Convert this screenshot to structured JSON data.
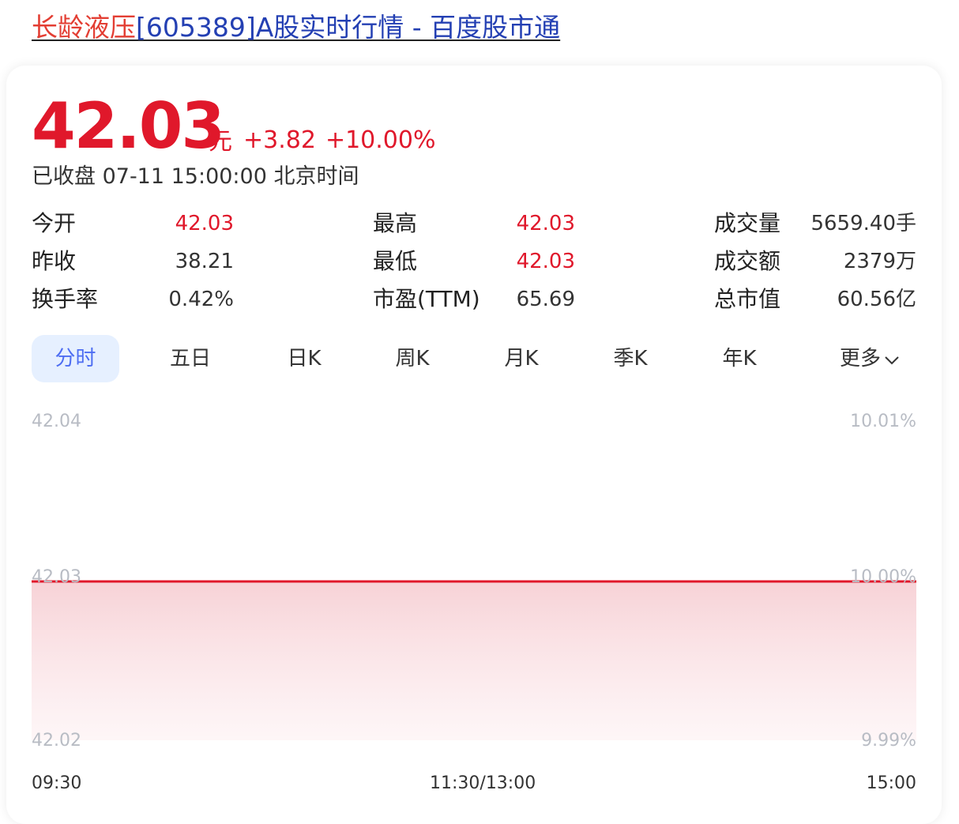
{
  "title": {
    "highlight": "长龄液压",
    "rest": "[605389]A股实时行情 - 百度股市通"
  },
  "quote": {
    "price": "42.03",
    "unit": "元",
    "change": "+3.82",
    "change_percent": "+10.00%",
    "status": "已收盘 07-11 15:00:00 北京时间"
  },
  "stats": {
    "open_label": "今开",
    "open_value": "42.03",
    "prev_close_label": "昨收",
    "prev_close_value": "38.21",
    "turnover_label": "换手率",
    "turnover_value": "0.42%",
    "high_label": "最高",
    "high_value": "42.03",
    "low_label": "最低",
    "low_value": "42.03",
    "pe_label": "市盈(TTM)",
    "pe_value": "65.69",
    "volume_label": "成交量",
    "volume_value": "5659.40手",
    "amount_label": "成交额",
    "amount_value": "2379万",
    "market_cap_label": "总市值",
    "market_cap_value": "60.56亿"
  },
  "tabs": {
    "t0": "分时",
    "t1": "五日",
    "t2": "日K",
    "t3": "周K",
    "t4": "月K",
    "t5": "季K",
    "t6": "年K",
    "t7": "更多",
    "active": "分时",
    "more_icon": "chevron-down-icon"
  },
  "colors": {
    "up": "#e0182b",
    "link": "#2440b3",
    "highlight": "#e33e33",
    "active_tab_bg": "#e6f0ff",
    "active_tab_text": "#4e6ef2",
    "axis": "#b8bcc4",
    "chart_line": "#e0182b"
  },
  "chart_data": {
    "type": "area",
    "title": "",
    "xlabel": "",
    "ylabel": "",
    "y_left_ticks": [
      "42.04",
      "42.03",
      "42.02"
    ],
    "y_right_ticks": [
      "10.01%",
      "10.00%",
      "9.99%"
    ],
    "x_ticks": [
      "09:30",
      "11:30/13:00",
      "15:00"
    ],
    "ylim": [
      42.02,
      42.04
    ],
    "grid": false,
    "series": [
      {
        "x": [
          "09:30",
          "11:30/13:00",
          "15:00"
        ],
        "values": [
          42.03,
          42.03,
          42.03
        ]
      }
    ]
  }
}
